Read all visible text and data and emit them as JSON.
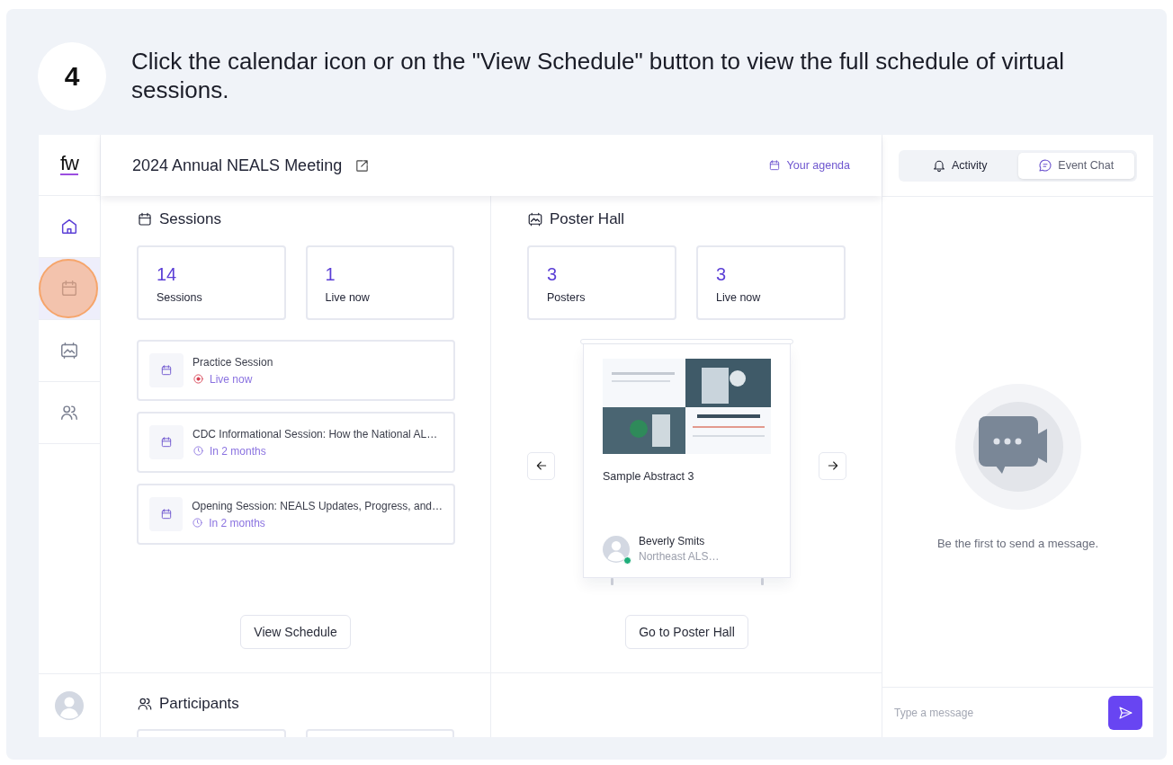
{
  "step": {
    "number": "4",
    "instruction": "Click the calendar icon or on the \"View Schedule\" button to view the full schedule of virtual sessions."
  },
  "sidebar": {
    "logo": "fw",
    "items": [
      {
        "kind": "home",
        "selected": false,
        "highlighted": false
      },
      {
        "kind": "calendar",
        "selected": true,
        "highlighted": true
      },
      {
        "kind": "poster",
        "selected": false,
        "highlighted": false
      },
      {
        "kind": "people",
        "selected": false,
        "highlighted": false
      }
    ]
  },
  "header": {
    "title": "2024 Annual NEALS Meeting",
    "agenda_link": "Your agenda"
  },
  "sessions": {
    "title": "Sessions",
    "stats": [
      {
        "value": "14",
        "label": "Sessions"
      },
      {
        "value": "1",
        "label": "Live now"
      }
    ],
    "items": [
      {
        "title": "Practice Session",
        "status": "Live now",
        "kind": "live"
      },
      {
        "title": "CDC Informational Session: How the National AL…",
        "status": "In 2 months",
        "kind": "upcoming"
      },
      {
        "title": "Opening Session: NEALS Updates, Progress, and…",
        "status": "In 2 months",
        "kind": "upcoming"
      }
    ],
    "button": "View Schedule"
  },
  "poster_hall": {
    "title": "Poster Hall",
    "stats": [
      {
        "value": "3",
        "label": "Posters"
      },
      {
        "value": "3",
        "label": "Live now"
      }
    ],
    "poster": {
      "title": "Sample Abstract 3",
      "author": "Beverly Smits",
      "affiliation": "Northeast ALS…",
      "online": true
    },
    "button": "Go to Poster Hall"
  },
  "participants": {
    "title": "Participants"
  },
  "chat": {
    "tabs": [
      {
        "label": "Activity",
        "kind": "bell",
        "selected": false
      },
      {
        "label": "Event Chat",
        "kind": "chat",
        "selected": true
      }
    ],
    "empty_message": "Be the first to send a message.",
    "placeholder": "Type a message"
  }
}
